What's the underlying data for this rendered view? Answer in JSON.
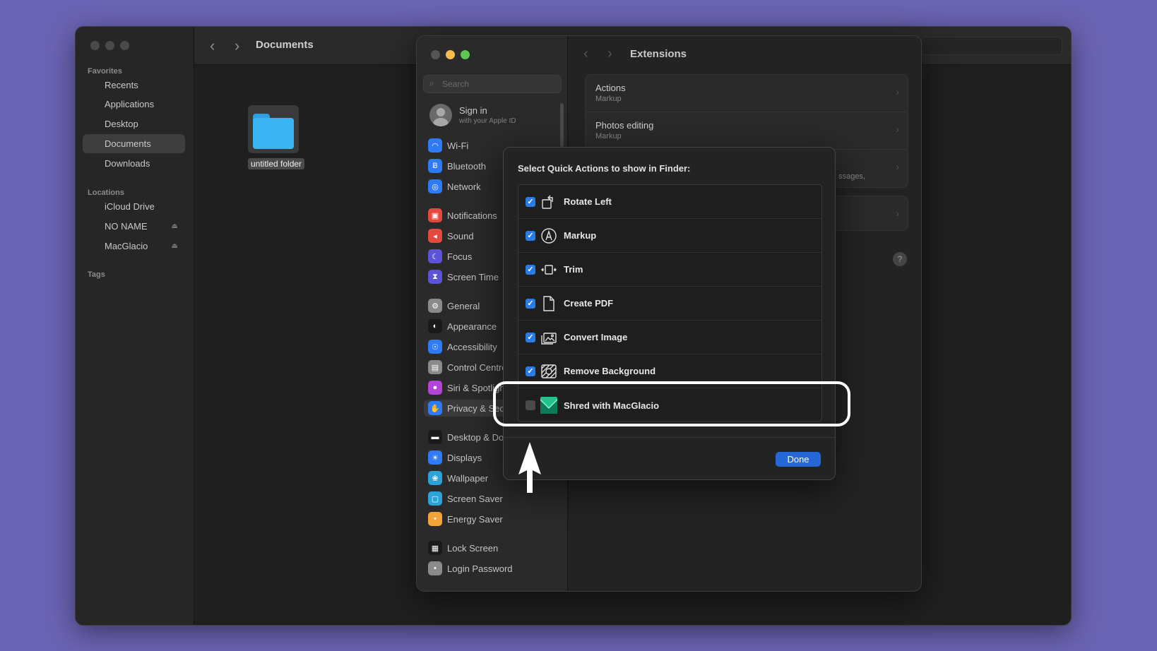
{
  "finder": {
    "title": "Documents",
    "favorites_header": "Favorites",
    "favorites": [
      "Recents",
      "Applications",
      "Desktop",
      "Documents",
      "Downloads"
    ],
    "locations_header": "Locations",
    "locations": [
      "iCloud Drive",
      "NO NAME",
      "MacGlacio"
    ],
    "tags_header": "Tags",
    "folder_label": "untitled folder"
  },
  "settings": {
    "search_placeholder": "Search",
    "signin_title": "Sign in",
    "signin_sub": "with your Apple ID",
    "items": [
      {
        "label": "Wi-Fi",
        "color": "#2f7bf5",
        "icon": "wifi-icon",
        "glyph": "◠"
      },
      {
        "label": "Bluetooth",
        "color": "#2f7bf5",
        "icon": "bluetooth-icon",
        "glyph": "Ƀ"
      },
      {
        "label": "Network",
        "color": "#2f7bf5",
        "icon": "globe-icon",
        "glyph": "◎"
      },
      {
        "label": "Notifications",
        "color": "#e5483f",
        "icon": "bell-icon",
        "glyph": "▣"
      },
      {
        "label": "Sound",
        "color": "#e5483f",
        "icon": "speaker-icon",
        "glyph": "◂"
      },
      {
        "label": "Focus",
        "color": "#5b54d6",
        "icon": "moon-icon",
        "glyph": "☾"
      },
      {
        "label": "Screen Time",
        "color": "#5b54d6",
        "icon": "hourglass-icon",
        "glyph": "⧗"
      },
      {
        "label": "General",
        "color": "#8a8a8a",
        "icon": "gear-icon",
        "glyph": "⚙"
      },
      {
        "label": "Appearance",
        "color": "#1a1a1a",
        "icon": "appearance-icon",
        "glyph": "◐"
      },
      {
        "label": "Accessibility",
        "color": "#2f7bf5",
        "icon": "accessibility-icon",
        "glyph": "☉"
      },
      {
        "label": "Control Centre",
        "color": "#8a8a8a",
        "icon": "control-centre-icon",
        "glyph": "▤"
      },
      {
        "label": "Siri & Spotlight",
        "color": "#b443d8",
        "icon": "siri-icon",
        "glyph": "●"
      },
      {
        "label": "Privacy & Security",
        "color": "#2f7bf5",
        "icon": "hand-icon",
        "glyph": "✋"
      },
      {
        "label": "Desktop & Dock",
        "color": "#1a1a1a",
        "icon": "dock-icon",
        "glyph": "▬"
      },
      {
        "label": "Displays",
        "color": "#2f7bf5",
        "icon": "sun-icon",
        "glyph": "☀"
      },
      {
        "label": "Wallpaper",
        "color": "#2ba3d6",
        "icon": "wallpaper-icon",
        "glyph": "❀"
      },
      {
        "label": "Screen Saver",
        "color": "#2ba3d6",
        "icon": "screen-saver-icon",
        "glyph": "▢"
      },
      {
        "label": "Energy Saver",
        "color": "#f2a33a",
        "icon": "bulb-icon",
        "glyph": "•"
      },
      {
        "label": "Lock Screen",
        "color": "#1a1a1a",
        "icon": "lock-icon",
        "glyph": "▦"
      },
      {
        "label": "Login Password",
        "color": "#8a8a8a",
        "icon": "key-icon",
        "glyph": "•"
      }
    ],
    "extensions_title": "Extensions",
    "ext_rows": [
      {
        "title": "Actions",
        "sub": "Markup"
      },
      {
        "title": "Photos editing",
        "sub": "Markup"
      },
      {
        "title": "",
        "sub": "ssages,"
      },
      {
        "title": "",
        "sub": ""
      }
    ],
    "help": "?"
  },
  "sheet": {
    "title": "Select Quick Actions to show in Finder:",
    "actions": [
      {
        "label": "Rotate Left",
        "checked": true,
        "icon": "rotate-left-icon"
      },
      {
        "label": "Markup",
        "checked": true,
        "icon": "markup-icon"
      },
      {
        "label": "Trim",
        "checked": true,
        "icon": "trim-icon"
      },
      {
        "label": "Create PDF",
        "checked": true,
        "icon": "document-icon"
      },
      {
        "label": "Convert Image",
        "checked": true,
        "icon": "photos-icon"
      },
      {
        "label": "Remove Background",
        "checked": true,
        "icon": "remove-background-icon"
      },
      {
        "label": "Shred with MacGlacio",
        "checked": false,
        "icon": "macglacio-icon"
      }
    ],
    "done_label": "Done",
    "check_glyph": "✓"
  }
}
